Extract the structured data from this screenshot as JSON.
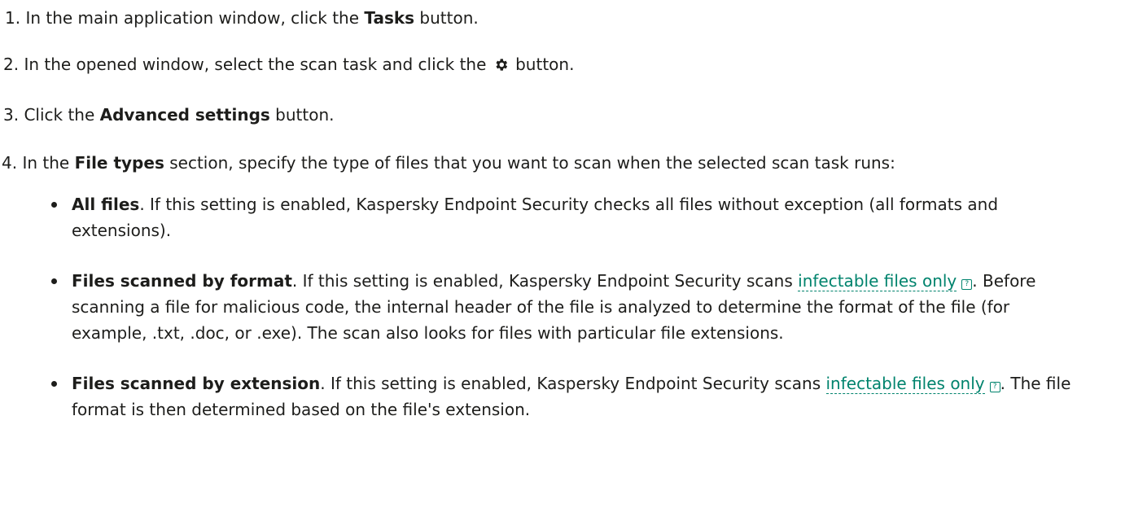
{
  "steps": {
    "s1": {
      "pre": "1. In the main application window, click the ",
      "bold": "Tasks",
      "post": " button."
    },
    "s2": {
      "pre": "2. In the opened window, select the scan task and click the ",
      "icon": "gear-icon",
      "post": " button."
    },
    "s3": {
      "pre": "3. Click the ",
      "bold": "Advanced settings",
      "post": " button."
    },
    "s4": {
      "pre": "4. In the ",
      "bold": "File types",
      "post": " section, specify the type of files that you want to scan when the selected scan task runs:"
    }
  },
  "bullets": [
    {
      "bold": "All files",
      "text": ". If this setting is enabled, Kaspersky Endpoint Security checks all files without exception (all formats and extensions)."
    },
    {
      "bold": "Files scanned by format",
      "pre": ". If this setting is enabled, Kaspersky Endpoint Security scans ",
      "link": "infectable files only",
      "post": ". Before scanning a file for malicious code, the internal header of the file is analyzed to determine the format of the file (for example, .txt, .doc, or .exe). The scan also looks for files with particular file extensions."
    },
    {
      "bold": "Files scanned by extension",
      "pre": ". If this setting is enabled, Kaspersky Endpoint Security scans ",
      "link": "infectable files only",
      "post": ". The file format is then determined based on the file's extension."
    }
  ],
  "colors": {
    "text": "#1d1d1b",
    "link": "#00836d"
  },
  "help_icon": {
    "name": "help-icon",
    "glyph": "?"
  }
}
